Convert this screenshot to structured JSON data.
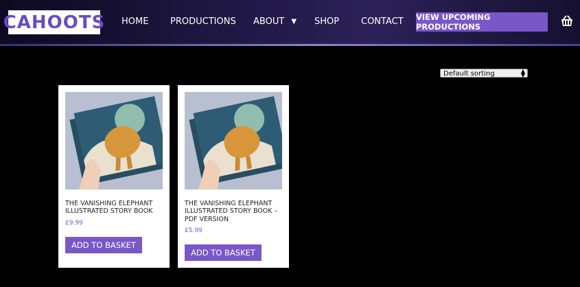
{
  "header": {
    "logo_text": "CAHOOTS",
    "nav": [
      {
        "label": "HOME"
      },
      {
        "label": "PRODUCTIONS"
      },
      {
        "label": "ABOUT"
      },
      {
        "label": "SHOP"
      },
      {
        "label": "CONTACT"
      }
    ],
    "cta_label": "VIEW UPCOMING PRODUCTIONS",
    "basket_icon": "basket-icon"
  },
  "sorting": {
    "selected": "Default sorting"
  },
  "products": [
    {
      "title": "THE VANISHING ELEPHANT ILLUSTRATED STORY BOOK",
      "price": "£9.99",
      "button_label": "ADD TO BASKET"
    },
    {
      "title": "THE VANISHING ELEPHANT ILLUSTRATED STORY BOOK – PDF VERSION",
      "price": "£5.99",
      "button_label": "ADD TO BASKET"
    }
  ],
  "colors": {
    "accent": "#7a57c9",
    "background": "#000000"
  }
}
